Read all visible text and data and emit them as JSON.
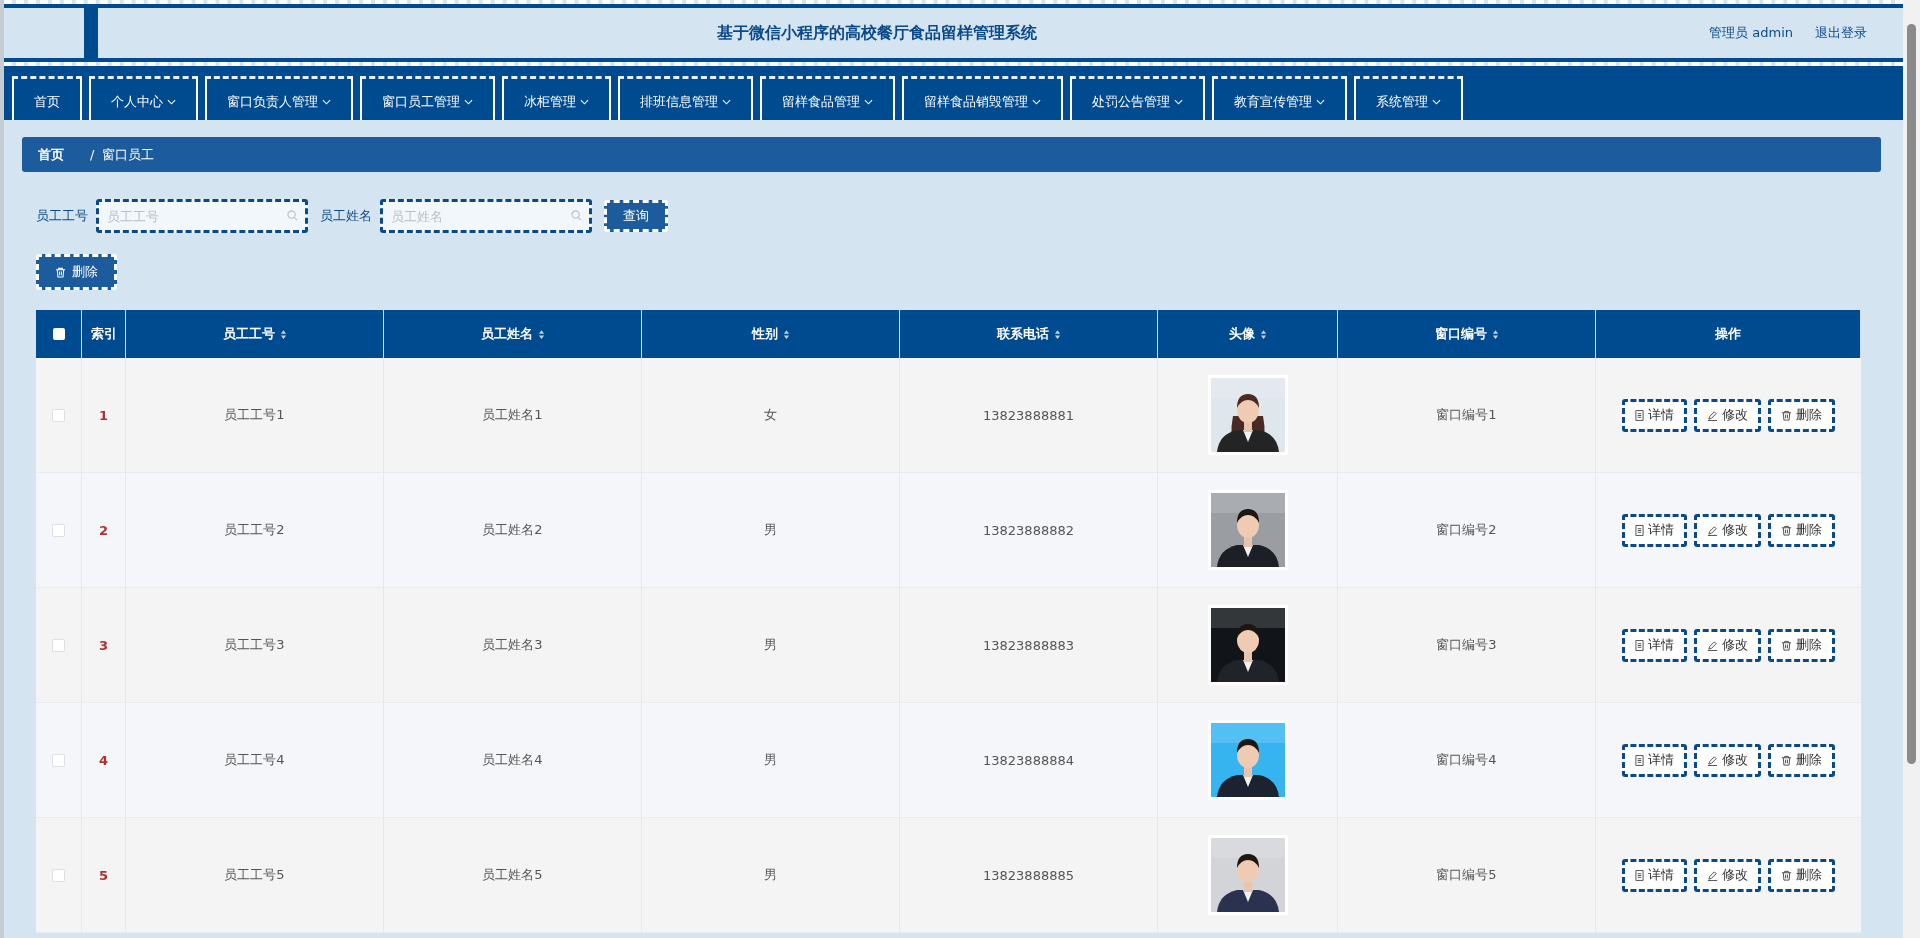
{
  "header": {
    "title": "基于微信小程序的高校餐厅食品留样管理系统",
    "user": "管理员 admin",
    "logout": "退出登录"
  },
  "nav": [
    {
      "label": "首页",
      "dropdown": false
    },
    {
      "label": "个人中心",
      "dropdown": true
    },
    {
      "label": "窗口负责人管理",
      "dropdown": true
    },
    {
      "label": "窗口员工管理",
      "dropdown": true
    },
    {
      "label": "冰柜管理",
      "dropdown": true
    },
    {
      "label": "排班信息管理",
      "dropdown": true
    },
    {
      "label": "留样食品管理",
      "dropdown": true
    },
    {
      "label": "留样食品销毁管理",
      "dropdown": true
    },
    {
      "label": "处罚公告管理",
      "dropdown": true
    },
    {
      "label": "教育宣传管理",
      "dropdown": true
    },
    {
      "label": "系统管理",
      "dropdown": true
    }
  ],
  "breadcrumb": {
    "items": [
      "首页",
      "窗口员工"
    ],
    "separator": "/"
  },
  "search": {
    "fields": [
      {
        "label": "员工工号",
        "placeholder": "员工工号"
      },
      {
        "label": "员工姓名",
        "placeholder": "员工姓名"
      }
    ],
    "button": "查询"
  },
  "delete_button": "删除",
  "table": {
    "select_all": {
      "checked": false
    },
    "columns": [
      {
        "label": "索引",
        "sortable": false
      },
      {
        "label": "员工工号",
        "sortable": true
      },
      {
        "label": "员工姓名",
        "sortable": true
      },
      {
        "label": "性别",
        "sortable": true
      },
      {
        "label": "联系电话",
        "sortable": true
      },
      {
        "label": "头像",
        "sortable": true
      },
      {
        "label": "窗口编号",
        "sortable": true
      },
      {
        "label": "操作",
        "sortable": false
      }
    ],
    "rows": [
      {
        "checked": false,
        "index": "1",
        "id": "员工工号1",
        "name": "员工姓名1",
        "gender": "女",
        "phone": "13823888881",
        "window": "窗口编号1",
        "actions": [
          "详情",
          "修改",
          "删除"
        ]
      },
      {
        "checked": false,
        "index": "2",
        "id": "员工工号2",
        "name": "员工姓名2",
        "gender": "男",
        "phone": "13823888882",
        "window": "窗口编号2",
        "actions": [
          "详情",
          "修改",
          "删除"
        ]
      },
      {
        "checked": false,
        "index": "3",
        "id": "员工工号3",
        "name": "员工姓名3",
        "gender": "男",
        "phone": "13823888883",
        "window": "窗口编号3",
        "actions": [
          "详情",
          "修改",
          "删除"
        ]
      },
      {
        "checked": false,
        "index": "4",
        "id": "员工工号4",
        "name": "员工姓名4",
        "gender": "男",
        "phone": "13823888884",
        "window": "窗口编号4",
        "actions": [
          "详情",
          "修改",
          "删除"
        ]
      },
      {
        "checked": false,
        "index": "5",
        "id": "员工工号5",
        "name": "员工姓名5",
        "gender": "男",
        "phone": "13823888885",
        "window": "窗口编号5",
        "actions": [
          "详情",
          "修改",
          "删除"
        ]
      }
    ]
  }
}
